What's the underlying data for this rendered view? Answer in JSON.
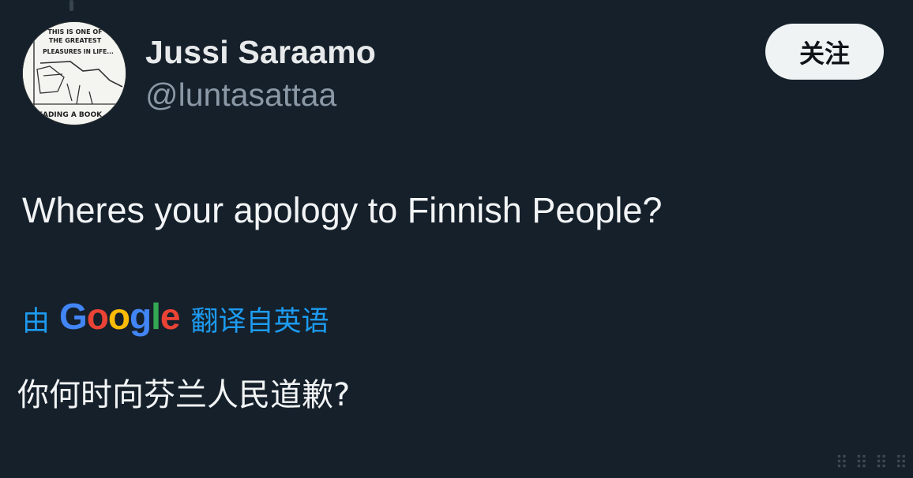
{
  "user": {
    "display_name": "Jussi Saraamo",
    "handle": "@luntasattaa",
    "avatar_caption_top": "THIS IS ONE OF THE GREATEST PLEASURES IN LIFE...",
    "avatar_caption_bottom": "READING A BOOK"
  },
  "follow_button": {
    "label": "关注"
  },
  "tweet": {
    "text": "Wheres your apology to Finnish People?"
  },
  "translation": {
    "prefix": "由",
    "brand": "Google",
    "suffix": "翻译自英语",
    "translated_text": "你何时向芬兰人民道歉?"
  },
  "colors": {
    "background": "#15202b",
    "link_blue": "#1d9bf0",
    "google_blue": "#4285f4",
    "google_red": "#ea4335",
    "google_yellow": "#fbbc05",
    "google_green": "#34a853"
  }
}
